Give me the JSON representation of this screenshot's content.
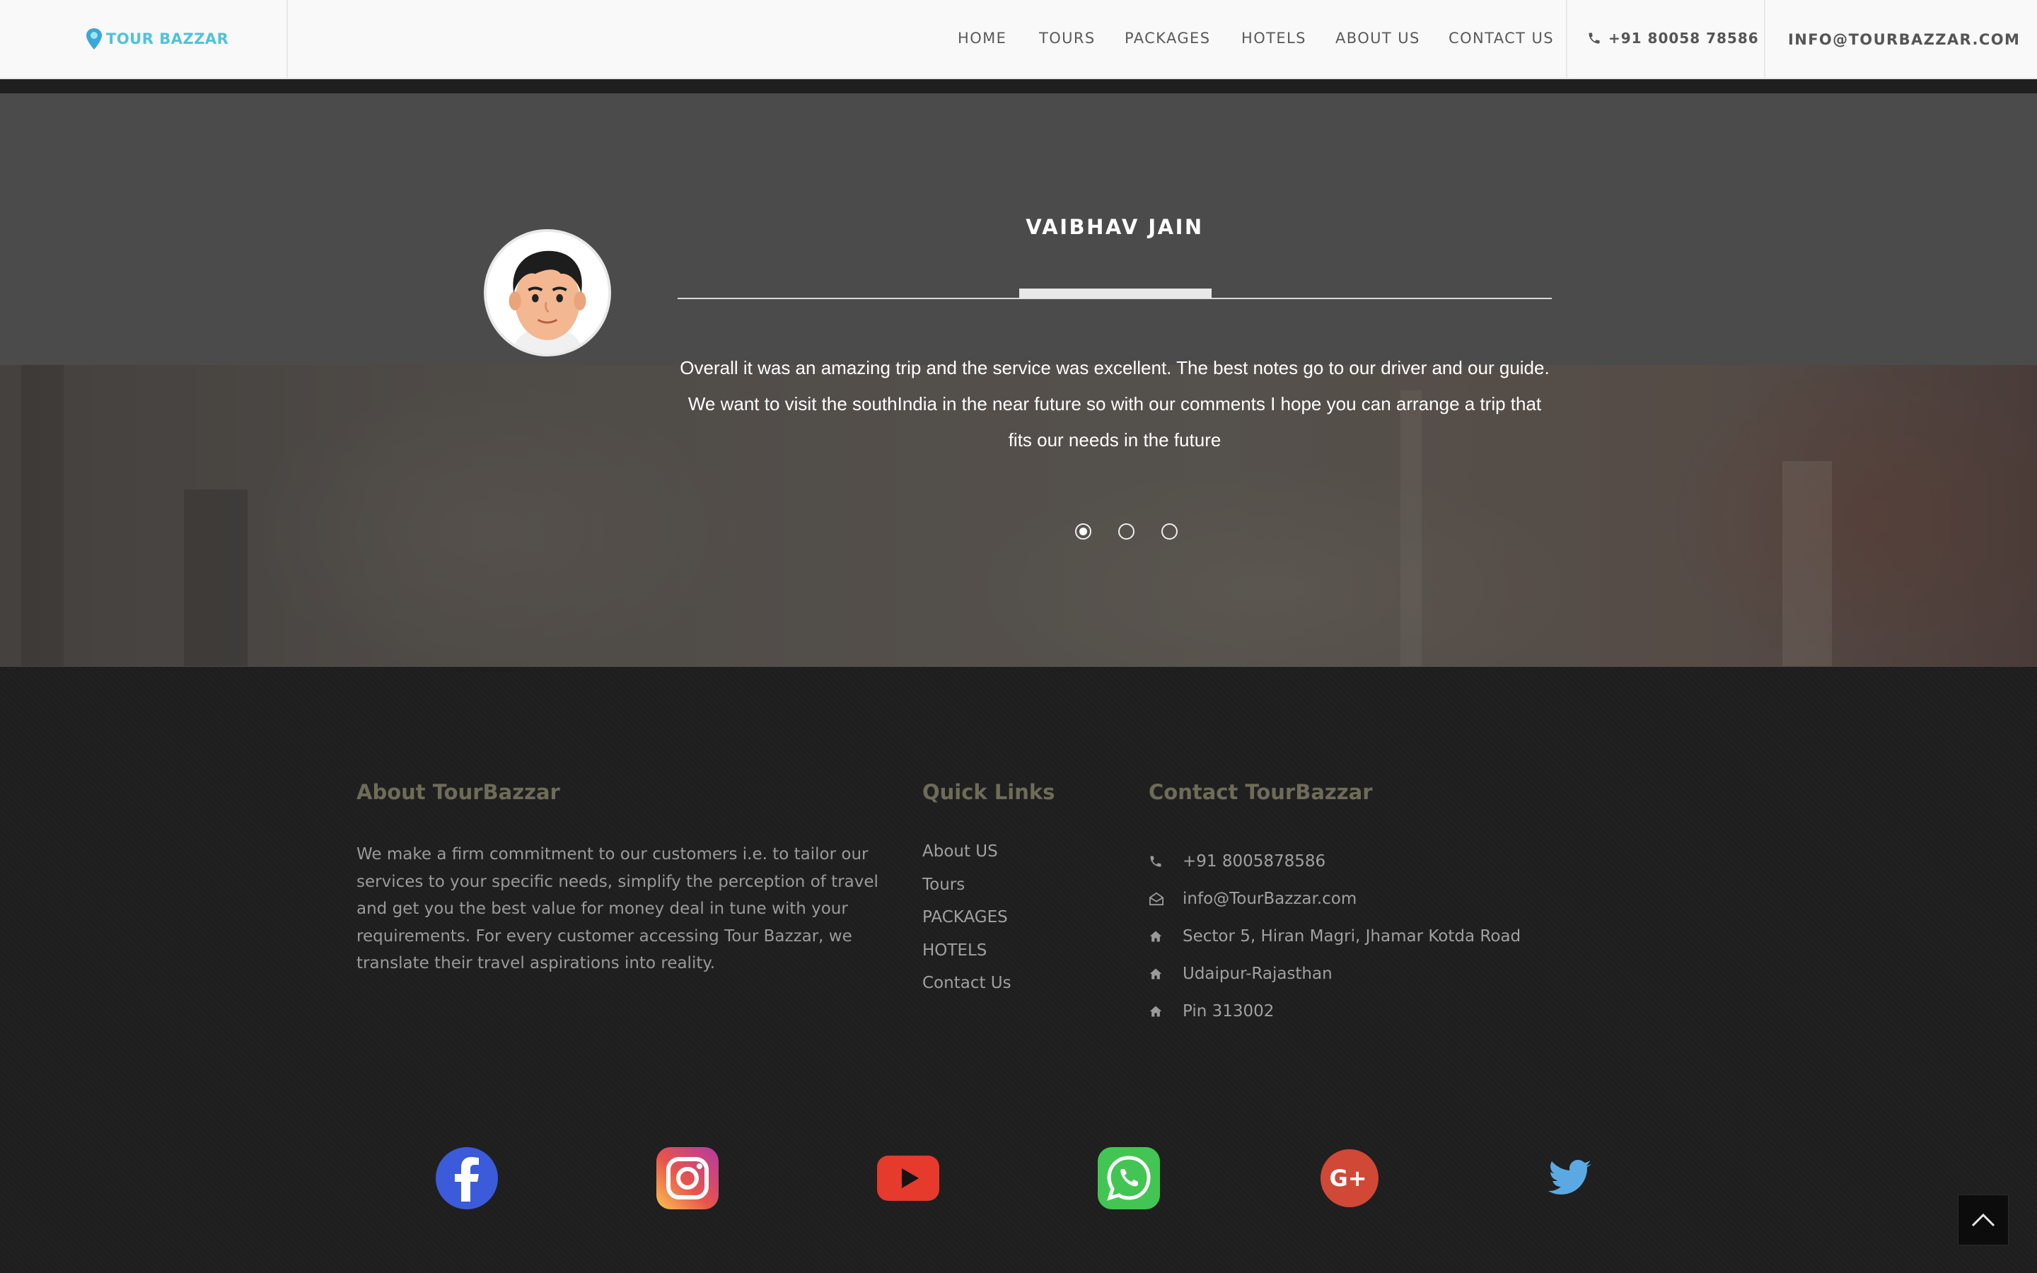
{
  "header": {
    "brand": "TOUR BAZZAR",
    "nav": [
      "HOME",
      "TOURS",
      "PACKAGES",
      "HOTELS",
      "ABOUT US",
      "CONTACT US"
    ],
    "phone": "+91 80058 78586",
    "email": "INFO@TOURBAZZAR.COM"
  },
  "testimonial": {
    "name": "VAIBHAV JAIN",
    "quote": "Overall it was an amazing trip and the service was excellent. The best notes go to our driver and our guide. We want to visit the southIndia in the near future so with our comments I hope you can arrange a trip that fits our needs in the future",
    "slides": 3,
    "active_slide": 1
  },
  "footer": {
    "about": {
      "heading": "About TourBazzar",
      "text": "We make a firm commitment to our customers i.e. to tailor our services to your specific needs, simplify the perception of travel and get you the best value for money deal in tune with your requirements. For every customer accessing Tour Bazzar, we translate their travel aspirations into reality."
    },
    "quick_links": {
      "heading": "Quick Links",
      "items": [
        "About US",
        "Tours",
        "PACKAGES",
        "HOTELS",
        "Contact Us"
      ]
    },
    "contact": {
      "heading": "Contact TourBazzar",
      "items": [
        {
          "icon": "phone-icon",
          "text": "+91 8005878586"
        },
        {
          "icon": "mail-icon",
          "text": "info@TourBazzar.com"
        },
        {
          "icon": "home-icon",
          "text": "Sector 5, Hiran Magri, Jhamar Kotda Road"
        },
        {
          "icon": "home-icon",
          "text": "Udaipur-Rajasthan"
        },
        {
          "icon": "home-icon",
          "text": "Pin 313002"
        }
      ]
    },
    "social": [
      "facebook-icon",
      "instagram-icon",
      "youtube-icon",
      "whatsapp-icon",
      "google-plus-icon",
      "twitter-icon"
    ]
  },
  "colors": {
    "brand": "#4fc3d9",
    "footer_heading": "#6e6c58",
    "facebook": "#3b5bdb",
    "youtube": "#e53a2c",
    "whatsapp": "#43c553",
    "google_plus": "#d14836",
    "twitter": "#5ba9e3"
  }
}
